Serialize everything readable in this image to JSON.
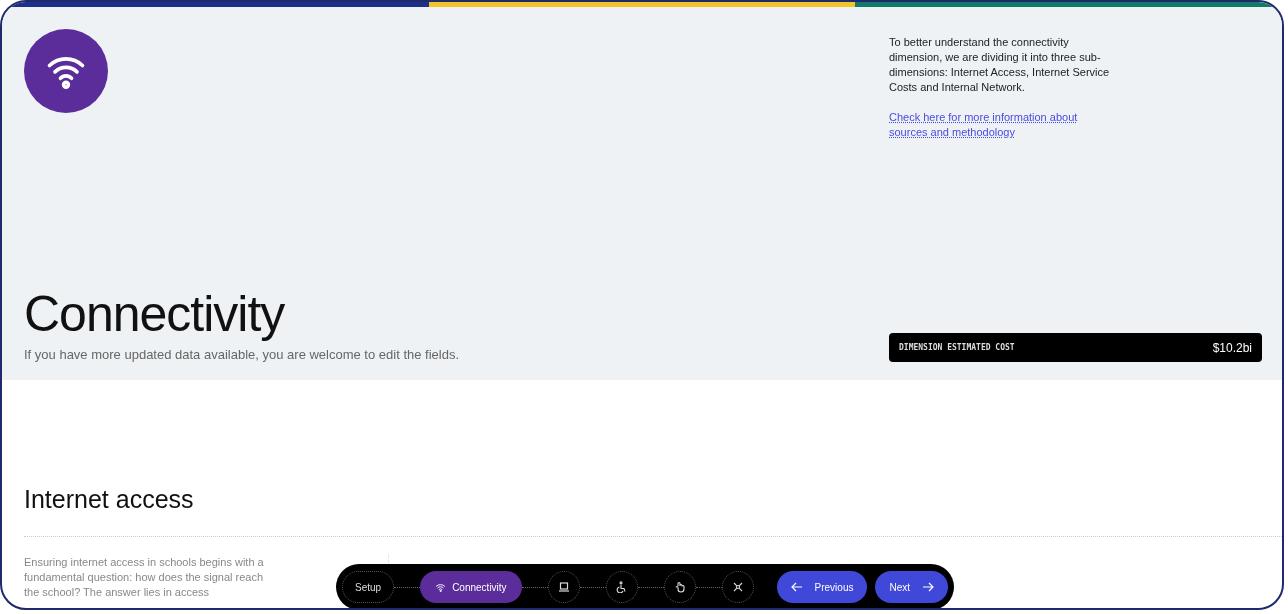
{
  "hero": {
    "title": "Connectivity",
    "subtitle": "If you have more updated data available, you are welcome to edit the fields.",
    "description": "To better understand the connectivity dimension, we are dividing it into three sub-dimensions: Internet Access, Internet Service Costs and Internal Network.",
    "link": "Check here for more information about sources and methodology",
    "cost": {
      "label": "DIMENSION ESTIMATED COST",
      "value": "$10.2bi"
    }
  },
  "section": {
    "heading": "Internet access",
    "body": "Ensuring internet access in schools begins with a fundamental question: how does the signal reach the school? The answer lies in access"
  },
  "stepper": {
    "steps": [
      {
        "kind": "text",
        "label": "Setup",
        "selected": false
      },
      {
        "kind": "wifi",
        "label": "Connectivity",
        "selected": true
      },
      {
        "kind": "laptop",
        "selected": false
      },
      {
        "kind": "person",
        "selected": false
      },
      {
        "kind": "hand",
        "selected": false
      },
      {
        "kind": "network",
        "selected": false
      }
    ],
    "previous": "Previous",
    "next": "Next"
  }
}
